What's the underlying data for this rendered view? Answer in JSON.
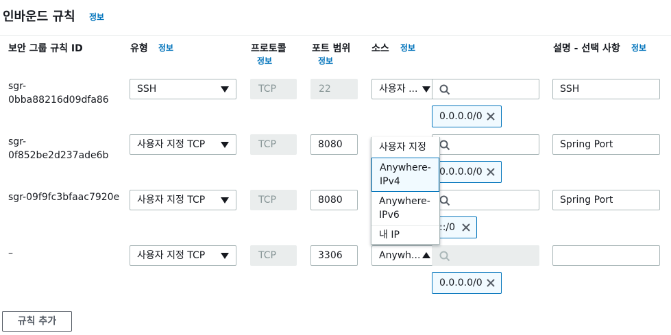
{
  "header": {
    "title": "인바운드 규칙",
    "info": "정보"
  },
  "columns": {
    "rule_id": "보안 그룹 규칙 ID",
    "type": "유형",
    "type_info": "정보",
    "protocol": "프로토콜",
    "protocol_info": "정보",
    "port_range": "포트 범위",
    "port_info": "정보",
    "source": "소스",
    "source_info": "정보",
    "description": "설명 - 선택 사항",
    "description_info": "정보"
  },
  "rules": [
    {
      "id_line1": "sgr-",
      "id_line2": "0bba88216d09dfa86",
      "type": "SSH",
      "protocol": "TCP",
      "port": "22",
      "source": "사용자 ...",
      "token": "0.0.0.0/0",
      "description": "SSH"
    },
    {
      "id_line1": "sgr-",
      "id_line2": "0f852be2d237ade6b",
      "type": "사용자 지정 TCP",
      "protocol": "TCP",
      "port": "8080",
      "source": "",
      "token": "0.0.0.0/0",
      "description": "Spring Port"
    },
    {
      "id_line1": "sgr-09f9fc3bfaac7920e",
      "id_line2": "",
      "type": "사용자 지정 TCP",
      "protocol": "TCP",
      "port": "8080",
      "source": "",
      "token": "::/0",
      "description": "Spring Port"
    },
    {
      "id_line1": "–",
      "id_line2": "",
      "type": "사용자 지정 TCP",
      "protocol": "TCP",
      "port": "3306",
      "source": "Anywh...",
      "token": "0.0.0.0/0",
      "description": ""
    }
  ],
  "source_dropdown": {
    "options": [
      "사용자 지정",
      "Anywhere-IPv4",
      "Anywhere-IPv6",
      "내 IP"
    ],
    "option_lines": {
      "custom": "사용자 지정",
      "ipv4_a": "Anywhere-",
      "ipv4_b": "IPv4",
      "ipv6_a": "Anywhere-",
      "ipv6_b": "IPv6",
      "myip": "내 IP"
    },
    "selected": "Anywhere-IPv4"
  },
  "buttons": {
    "add_rule": "규칙 추가"
  },
  "colors": {
    "link": "#0073bb",
    "border": "#aab7b8",
    "disabled_bg": "#eaeded",
    "token_bg": "#f1faff"
  },
  "icons": [
    "search-icon",
    "close-icon",
    "caret-down-icon",
    "caret-up-icon"
  ]
}
